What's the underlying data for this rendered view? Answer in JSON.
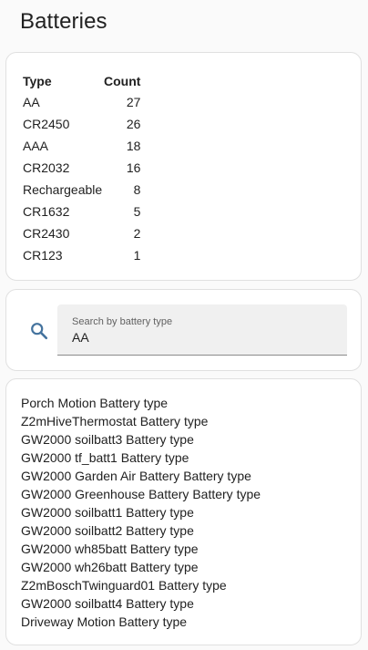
{
  "page": {
    "title": "Batteries"
  },
  "count_table": {
    "headers": {
      "type": "Type",
      "count": "Count"
    },
    "rows": [
      {
        "type": "AA",
        "count": "27"
      },
      {
        "type": "CR2450",
        "count": "26"
      },
      {
        "type": "AAA",
        "count": "18"
      },
      {
        "type": "CR2032",
        "count": "16"
      },
      {
        "type": "Rechargeable",
        "count": "8"
      },
      {
        "type": "CR1632",
        "count": "5"
      },
      {
        "type": "CR2430",
        "count": "2"
      },
      {
        "type": "CR123",
        "count": "1"
      }
    ]
  },
  "search": {
    "icon": "search-icon",
    "label": "Search by battery type",
    "value": "AA",
    "accent_color": "#44739e"
  },
  "results": [
    "Porch Motion Battery type",
    "Z2mHiveThermostat Battery type",
    "GW2000 soilbatt3 Battery type",
    "GW2000 tf_batt1 Battery type",
    "GW2000 Garden Air Battery Battery type",
    "GW2000 Greenhouse Battery Battery type",
    "GW2000 soilbatt1 Battery type",
    "GW2000 soilbatt2 Battery type",
    "GW2000 wh85batt Battery type",
    "GW2000 wh26batt Battery type",
    "Z2mBoschTwinguard01 Battery type",
    "GW2000 soilbatt4 Battery type",
    "Driveway Motion Battery type"
  ]
}
